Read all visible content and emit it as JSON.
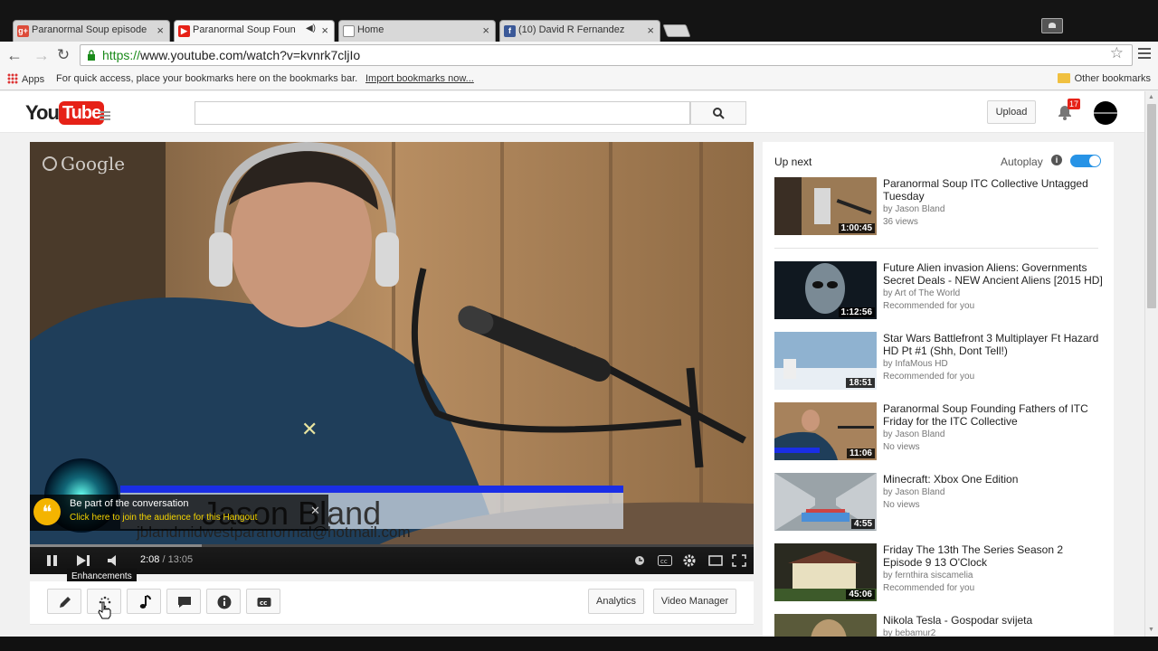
{
  "browser": {
    "tabs": [
      {
        "label": "Paranormal Soup episode",
        "icon": "google-plus-icon",
        "color": "#dd4b39"
      },
      {
        "label": "Paranormal Soup Foun",
        "icon": "youtube-icon",
        "color": "#e62117"
      },
      {
        "label": "Home",
        "icon": "page-icon",
        "color": "#ffffff"
      },
      {
        "label": "(10) David R Fernandez",
        "icon": "facebook-icon",
        "color": "#3b5998"
      }
    ],
    "url_https": "https://",
    "url_rest": "www.youtube.com/watch?v=kvnrk7cljIo",
    "bookmarks": {
      "apps": "Apps",
      "hint": "For quick access, place your bookmarks here on the bookmarks bar.",
      "import": "Import bookmarks now...",
      "other": "Other bookmarks"
    }
  },
  "youtube": {
    "logo_you": "You",
    "logo_tube": "Tube",
    "upload": "Upload",
    "notifications": "17",
    "brand_color": "#e62117"
  },
  "player": {
    "watermark": "Google",
    "overlay_name": "Jason Bland",
    "overlay_email": "jblandmidwestparanormal@hotmail.com",
    "hangout_title": "Be part of the conversation",
    "hangout_link": "Click here to join the audience for this Hangout",
    "time_current": "2:08",
    "time_sep": " / ",
    "time_total": "13:05",
    "progress": 0.163,
    "tooltip": "Enhancements"
  },
  "actions": {
    "analytics": "Analytics",
    "video_manager": "Video Manager"
  },
  "sidebar": {
    "up_next": "Up next",
    "autoplay": "Autoplay",
    "autoplay_on": true,
    "videos": [
      {
        "title": "Paranormal Soup ITC Collective Untagged Tuesday",
        "by": "by Jason Bland",
        "meta": "36 views",
        "duration": "1:00:45"
      },
      {
        "title": "Future Alien invasion Aliens: Governments Secret Deals - NEW Ancient Aliens [2015 HD]",
        "by": "by Art of The World",
        "meta": "Recommended for you",
        "duration": "1:12:56"
      },
      {
        "title": "Star Wars Battlefront 3 Multiplayer Ft Hazard HD Pt #1 (Shh, Dont Tell!)",
        "by": "by InfaMous HD",
        "meta": "Recommended for you",
        "duration": "18:51"
      },
      {
        "title": "Paranormal Soup Founding Fathers of ITC Friday for the ITC Collective",
        "by": "by Jason Bland",
        "meta": "No views",
        "duration": "11:06"
      },
      {
        "title": "Minecraft: Xbox One Edition",
        "by": "by Jason Bland",
        "meta": "No views",
        "duration": "4:55"
      },
      {
        "title": "Friday The 13th The Series Season 2 Episode 9 13 O'Clock",
        "by": "by fernthira siscamelia",
        "meta": "Recommended for you",
        "duration": "45:06"
      },
      {
        "title": "Nikola Tesla - Gospodar svijeta",
        "by": "by bebamur2",
        "meta": "",
        "duration": ""
      }
    ]
  }
}
